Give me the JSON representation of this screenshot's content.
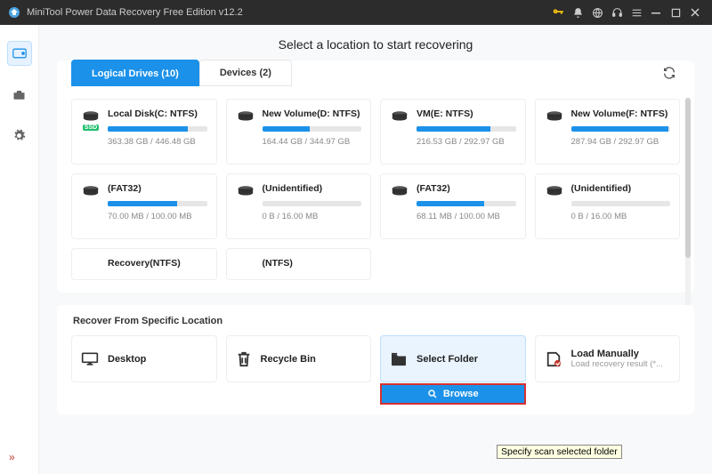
{
  "title": "MiniTool Power Data Recovery Free Edition v12.2",
  "heading": "Select a location to start recovering",
  "tabs": {
    "logical": "Logical Drives (10)",
    "devices": "Devices (2)"
  },
  "drives": [
    {
      "name": "Local Disk(C: NTFS)",
      "size": "363.38 GB / 446.48 GB",
      "pct": 81,
      "ssd": "SSD"
    },
    {
      "name": "New Volume(D: NTFS)",
      "size": "164.44 GB / 344.97 GB",
      "pct": 48,
      "ssd": ""
    },
    {
      "name": "VM(E: NTFS)",
      "size": "216.53 GB / 292.97 GB",
      "pct": 74,
      "ssd": ""
    },
    {
      "name": "New Volume(F: NTFS)",
      "size": "287.94 GB / 292.97 GB",
      "pct": 98,
      "ssd": ""
    },
    {
      "name": "(FAT32)",
      "size": "70.00 MB / 100.00 MB",
      "pct": 70,
      "ssd": ""
    },
    {
      "name": "(Unidentified)",
      "size": "0 B / 16.00 MB",
      "pct": 0,
      "ssd": ""
    },
    {
      "name": "(FAT32)",
      "size": "68.11 MB / 100.00 MB",
      "pct": 68,
      "ssd": ""
    },
    {
      "name": "(Unidentified)",
      "size": "0 B / 16.00 MB",
      "pct": 0,
      "ssd": ""
    }
  ],
  "drives_short": [
    {
      "name": "Recovery(NTFS)"
    },
    {
      "name": "(NTFS)"
    }
  ],
  "section_title": "Recover From Specific Location",
  "locations": {
    "desktop": "Desktop",
    "recycle": "Recycle Bin",
    "folder": "Select Folder",
    "manual": "Load Manually",
    "manual_sub": "Load recovery result (*...",
    "browse": "Browse"
  },
  "tooltip": "Specify scan selected folder",
  "collapse_glyph": "»"
}
